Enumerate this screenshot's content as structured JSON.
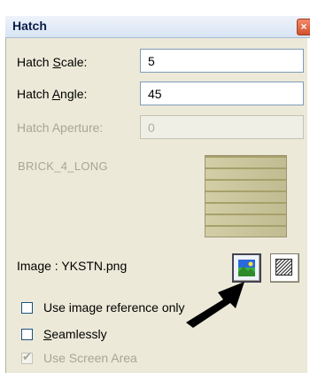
{
  "window": {
    "title": "Hatch",
    "close_glyph": "×"
  },
  "fields": {
    "scale": {
      "label_pre": "Hatch ",
      "label_u": "S",
      "label_post": "cale:",
      "value": "5"
    },
    "angle": {
      "label_pre": "Hatch ",
      "label_u": "A",
      "label_post": "ngle:",
      "value": "45"
    },
    "aperture": {
      "label": "Hatch Aperture:",
      "value": "0"
    }
  },
  "pattern": {
    "name": "BRICK_4_LONG"
  },
  "image": {
    "label": "Image :  YKSTN.png",
    "picture_button_icon": "image-icon",
    "hatch_button_icon": "hatch-pattern-icon"
  },
  "options": {
    "use_image_reference": {
      "label": "Use image reference only",
      "checked": false
    },
    "seamlessly": {
      "label_u": "S",
      "label_post": "eamlessly",
      "checked": false
    },
    "use_screen_area": {
      "label": "Use Screen Area",
      "checked": true,
      "disabled": true
    }
  },
  "colors": {
    "panel": "#ece9d8",
    "titlebar": "#d8e4f3",
    "close": "#d2522e",
    "disabled_text": "#a7a696"
  }
}
